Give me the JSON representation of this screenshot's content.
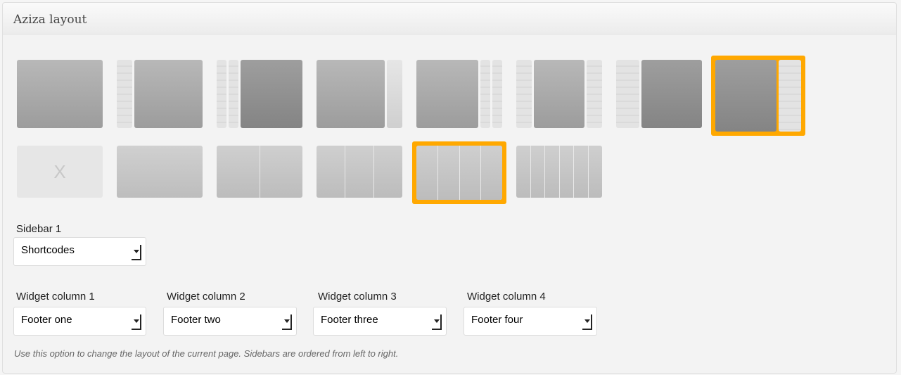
{
  "panel": {
    "title": "Aziza layout"
  },
  "layouts": {
    "selected_main": "layout-8",
    "selected_footer": "footer-4"
  },
  "none_option": {
    "mark": "X"
  },
  "sidebar1": {
    "label": "Sidebar 1",
    "value": "Shortcodes"
  },
  "widgets": [
    {
      "label": "Widget column 1",
      "value": "Footer one"
    },
    {
      "label": "Widget column 2",
      "value": "Footer two"
    },
    {
      "label": "Widget column 3",
      "value": "Footer three"
    },
    {
      "label": "Widget column 4",
      "value": "Footer four"
    }
  ],
  "hint": "Use this option to change the layout of the current page. Sidebars are ordered from left to right.",
  "colors": {
    "selection": "#ffa800"
  }
}
